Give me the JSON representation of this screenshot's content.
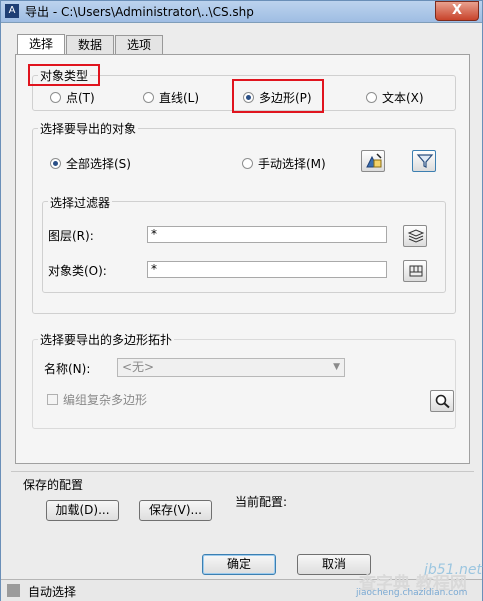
{
  "window": {
    "title": "导出 - C:\\Users\\Administrator\\..\\CS.shp",
    "close_label": "X"
  },
  "tabs": [
    {
      "label": "选择"
    },
    {
      "label": "数据"
    },
    {
      "label": "选项"
    }
  ],
  "object_type": {
    "title": "对象类型",
    "options": [
      {
        "label": "点(T)",
        "selected": false
      },
      {
        "label": "直线(L)",
        "selected": false
      },
      {
        "label": "多边形(P)",
        "selected": true
      },
      {
        "label": "文本(X)",
        "selected": false
      }
    ]
  },
  "select_objects": {
    "title": "选择要导出的对象",
    "select_all": "全部选择(S)",
    "manual_select": "手动选择(M)",
    "filter": {
      "title": "选择过滤器",
      "layer_label": "图层(R):",
      "layer_value": "*",
      "class_label": "对象类(O):",
      "class_value": "*"
    }
  },
  "topology": {
    "title": "选择要导出的多边形拓扑",
    "name_label": "名称(N):",
    "name_value": "<无>",
    "group_checkbox": "编组复杂多边形"
  },
  "saved_config": {
    "title": "保存的配置",
    "load_button": "加载(D)...",
    "save_button": "保存(V)...",
    "current_label": "当前配置:"
  },
  "footer": {
    "ok_button": "确定",
    "cancel_button": "取消"
  },
  "status": {
    "text": "自动选择"
  },
  "watermark": {
    "site": "jb51.net",
    "brand": "查字典 教程网",
    "url": "jiaocheng.chazidian.com"
  },
  "colors": {
    "highlight_border": "#e0141e",
    "radio_dot": "#2a4f86"
  }
}
